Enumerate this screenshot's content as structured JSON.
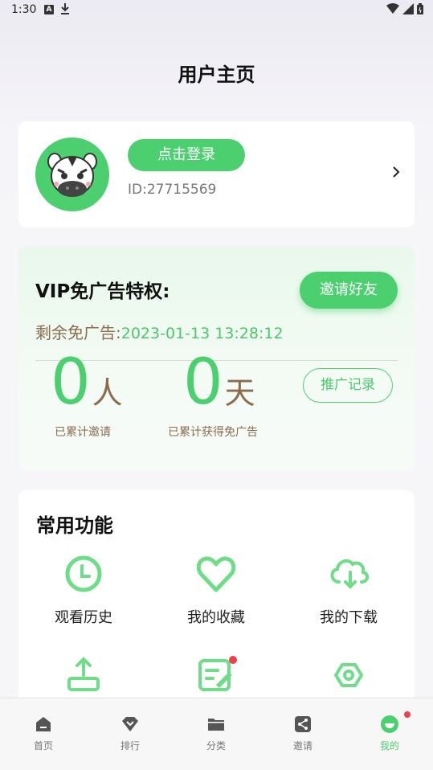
{
  "status_bar": {
    "time": "1:30",
    "a_icon": "A"
  },
  "page": {
    "title": "用户主页"
  },
  "profile": {
    "login_label": "点击登录",
    "user_id": "ID:27715569"
  },
  "vip": {
    "title": "VIP免广告特权:",
    "invite_label": "邀请好友",
    "remain_label": "剩余免广告:",
    "remain_date": "2023-01-13 13:28:12",
    "invited_count": "0",
    "invited_unit": "人",
    "invited_label": "已累计邀请",
    "days_count": "0",
    "days_unit": "天",
    "days_label": "已累计获得免广告",
    "promo_label": "推广记录"
  },
  "functions": {
    "title": "常用功能",
    "items": [
      {
        "label": "观看历史",
        "icon": "clock-icon"
      },
      {
        "label": "我的收藏",
        "icon": "heart-icon"
      },
      {
        "label": "我的下载",
        "icon": "cloud-download-icon"
      },
      {
        "label": "",
        "icon": "upload-icon"
      },
      {
        "label": "",
        "icon": "edit-icon"
      },
      {
        "label": "",
        "icon": "settings-hexagon-icon"
      }
    ]
  },
  "tabs": [
    {
      "label": "首页",
      "icon": "home-icon"
    },
    {
      "label": "排行",
      "icon": "ranking-icon"
    },
    {
      "label": "分类",
      "icon": "folder-icon"
    },
    {
      "label": "邀请",
      "icon": "share-icon"
    },
    {
      "label": "我的",
      "icon": "profile-icon",
      "active": true
    }
  ],
  "colors": {
    "accent": "#4cd06f",
    "brown": "#8a6d4e",
    "badge": "#f0414a"
  }
}
